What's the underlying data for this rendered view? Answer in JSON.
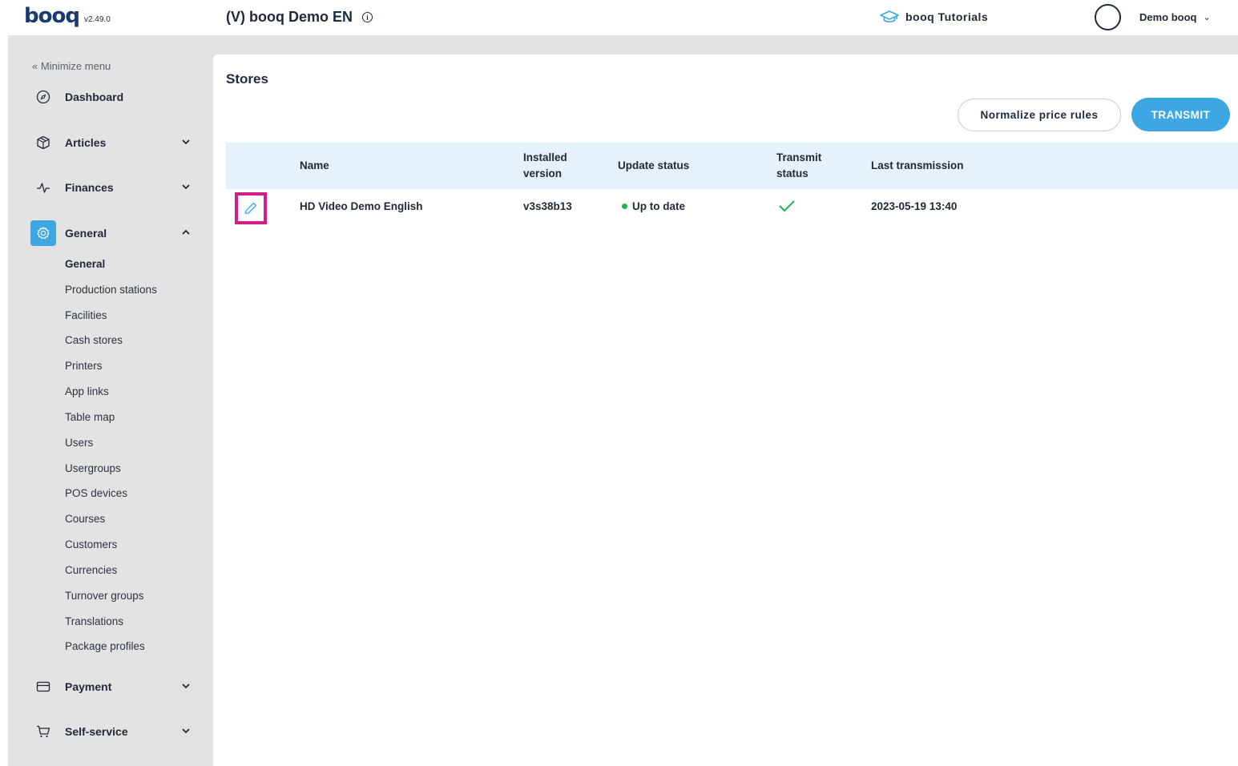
{
  "header": {
    "logo_text": "booq",
    "version": "v2.49.0",
    "venue_name": "(V) booq Demo EN",
    "tutorials_label": "booq Tutorials",
    "user_name": "Demo booq"
  },
  "sidebar": {
    "minimize_label": "Minimize menu",
    "items": [
      {
        "label": "Dashboard",
        "icon": "compass-icon"
      },
      {
        "label": "Articles",
        "icon": "box-icon"
      },
      {
        "label": "Finances",
        "icon": "pulse-icon"
      },
      {
        "label": "General",
        "icon": "gear-icon",
        "active": true
      },
      {
        "label": "Payment",
        "icon": "card-icon"
      },
      {
        "label": "Self-service",
        "icon": "cart-icon"
      }
    ],
    "general_sub": [
      "General",
      "Production stations",
      "Facilities",
      "Cash stores",
      "Printers",
      "App links",
      "Table map",
      "Users",
      "Usergroups",
      "POS devices",
      "Courses",
      "Customers",
      "Currencies",
      "Turnover groups",
      "Translations",
      "Package profiles"
    ]
  },
  "main": {
    "title": "Stores",
    "normalize_label": "Normalize price rules",
    "transmit_label": "TRANSMIT",
    "columns": {
      "name": "Name",
      "installed_version_1": "Installed",
      "installed_version_2": "version",
      "update_status": "Update status",
      "transmit_status_1": "Transmit",
      "transmit_status_2": "status",
      "last_transmission": "Last transmission"
    },
    "rows": [
      {
        "name": "HD Video Demo English",
        "installed_version": "v3s38b13",
        "update_status": "Up to date",
        "transmit_status": "check-icon",
        "last_transmission": "2023-05-19 13:40"
      }
    ]
  },
  "colors": {
    "accent": "#3da7e4",
    "highlight": "#d41c8c",
    "status_ok": "#22b34d",
    "sidebar_bg": "#e3e3e3",
    "table_header_bg": "#e3f2fb"
  }
}
